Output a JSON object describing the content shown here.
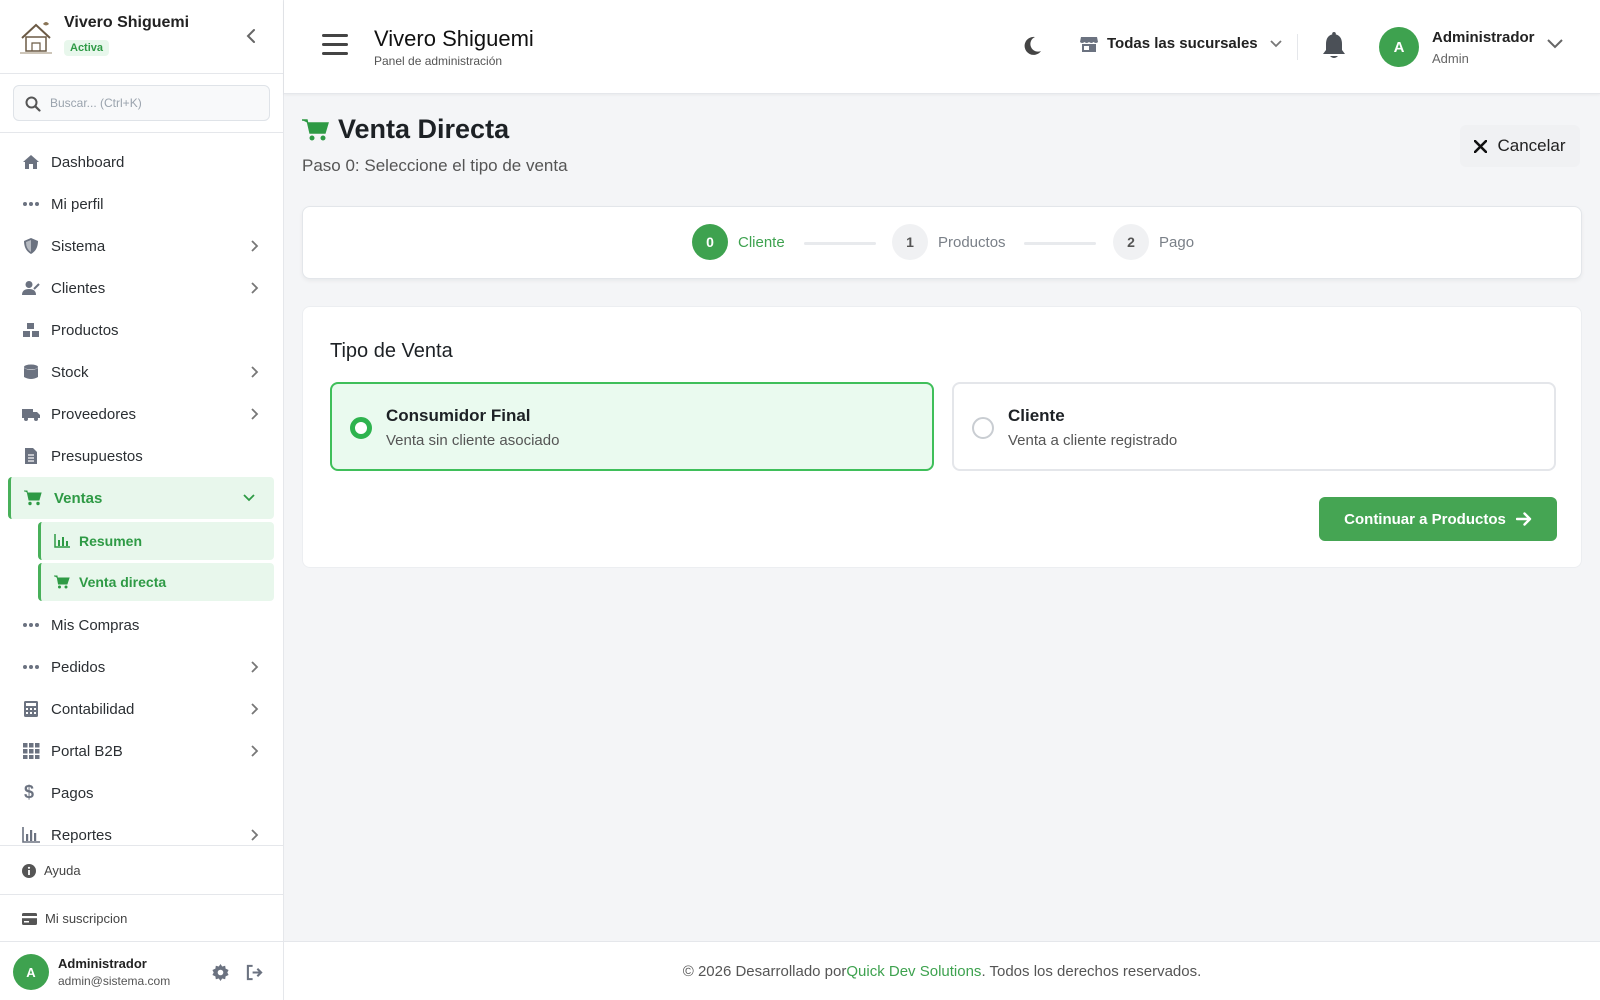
{
  "brand": {
    "name": "Vivero Shiguemi",
    "status": "Activa",
    "logo_icon": "logo-house-icon"
  },
  "search": {
    "placeholder": "Buscar... (Ctrl+K)",
    "value": ""
  },
  "nav": {
    "items": [
      {
        "label": "Dashboard",
        "icon": "home-icon"
      },
      {
        "label": "Mi perfil",
        "icon": "dots-icon"
      },
      {
        "label": "Sistema",
        "icon": "shield-icon",
        "expandable": true
      },
      {
        "label": "Clientes",
        "icon": "users-icon",
        "expandable": true
      },
      {
        "label": "Productos",
        "icon": "boxes-icon"
      },
      {
        "label": "Stock",
        "icon": "database-icon",
        "expandable": true
      },
      {
        "label": "Proveedores",
        "icon": "truck-icon",
        "expandable": true
      },
      {
        "label": "Presupuestos",
        "icon": "document-icon"
      },
      {
        "label": "Ventas",
        "icon": "cart-icon",
        "expanded": true
      },
      {
        "label": "Mis Compras",
        "icon": "dots-icon"
      },
      {
        "label": "Pedidos",
        "icon": "dots-icon",
        "expandable": true
      },
      {
        "label": "Contabilidad",
        "icon": "calculator-icon",
        "expandable": true
      },
      {
        "label": "Portal B2B",
        "icon": "grid-icon",
        "expandable": true
      },
      {
        "label": "Pagos",
        "icon": "dollar-icon"
      },
      {
        "label": "Reportes",
        "icon": "chart-icon",
        "expandable": true
      }
    ],
    "ventas_sub": [
      {
        "label": "Resumen",
        "icon": "chart-icon"
      },
      {
        "label": "Venta directa",
        "icon": "cart-icon"
      }
    ]
  },
  "sidebar_footer": {
    "help": "Ayuda",
    "subscription": "Mi suscripcion"
  },
  "sidebar_user": {
    "initial": "A",
    "name": "Administrador",
    "email": "admin@sistema.com"
  },
  "header": {
    "title": "Vivero Shiguemi",
    "subtitle": "Panel de administración",
    "branch": "Todas las sucursales",
    "user_initial": "A",
    "user_name": "Administrador",
    "user_role": "Admin"
  },
  "page": {
    "title": "Venta Directa",
    "subtitle": "Paso 0: Seleccione el tipo de venta",
    "cancel_label": "Cancelar"
  },
  "steps": [
    {
      "number": "0",
      "label": "Cliente",
      "active": true
    },
    {
      "number": "1",
      "label": "Productos",
      "active": false
    },
    {
      "number": "2",
      "label": "Pago",
      "active": false
    }
  ],
  "sale_type": {
    "title": "Tipo de Venta",
    "options": [
      {
        "title": "Consumidor Final",
        "description": "Venta sin cliente asociado",
        "selected": true
      },
      {
        "title": "Cliente",
        "description": "Venta a cliente registrado",
        "selected": false
      }
    ],
    "continue_label": "Continuar a Productos"
  },
  "footer": {
    "prefix": "© 2026 Desarrollado por ",
    "link": "Quick Dev Solutions",
    "suffix": ". Todos los derechos reservados."
  },
  "colors": {
    "accent": "#3ea24f",
    "accent_light": "#e8f7ec",
    "selected_border": "#3fbf5a"
  }
}
